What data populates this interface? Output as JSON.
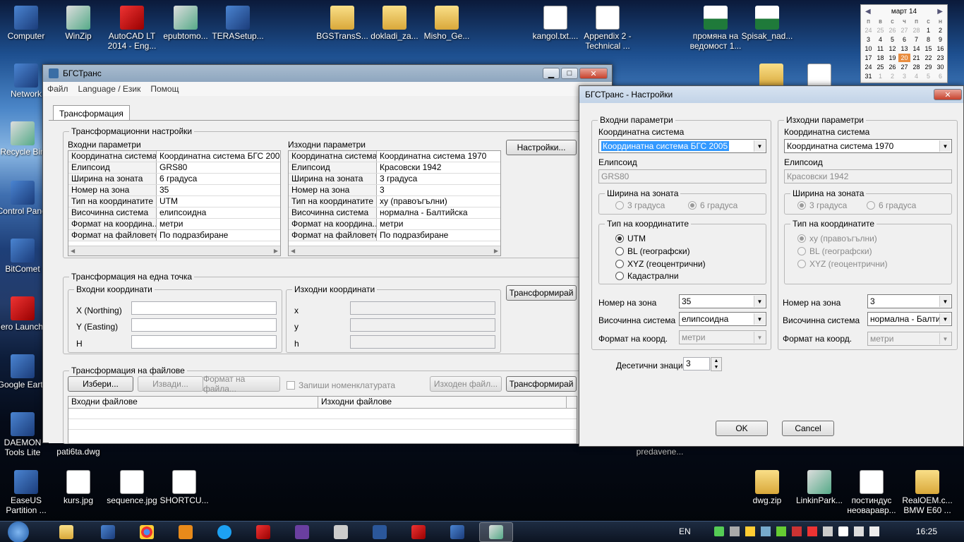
{
  "desktop_icons": {
    "computer": "Computer",
    "winzip": "WinZip",
    "autocad": "AutoCAD LT 2014 - Eng...",
    "epub": "epubtomo...",
    "tera": "TERASetup...",
    "bgstrans": "BGSTransS...",
    "dokladi": "dokladi_za...",
    "misho": "Misho_Ge...",
    "kangol": "kangol.txt....",
    "appendix": "Appendix 2 - Technical ...",
    "promyana": "промяна на ведомост 1...",
    "spisak": "Spisak_nad...",
    "network": "Network",
    "recycle": "Recycle Bin",
    "control": "Control Panel",
    "bitcomet": "BitComet",
    "nero": "Nero Launcher",
    "google": "Google Earth",
    "daemon": "DAEMON Tools Lite",
    "pati": "pati6ta.dwg",
    "easeus": "EaseUS Partition ...",
    "kurs": "kurs.jpg",
    "sequence": "sequence.jpg",
    "shortcut": "SHORTCU...",
    "predavane": "predavene...",
    "dwgzip": "dwg.zip",
    "linkin": "LinkinPark...",
    "postind": "постиндус неоваравр...",
    "realoem": "RealOEM.c... BMW E60 ..."
  },
  "calendar": {
    "month": "март 14",
    "prev": "◀",
    "next": "▶",
    "days": [
      "п",
      "в",
      "с",
      "ч",
      "п",
      "с",
      "н"
    ],
    "rows": [
      [
        "24",
        "25",
        "26",
        "27",
        "28",
        "1",
        "2"
      ],
      [
        "3",
        "4",
        "5",
        "6",
        "7",
        "8",
        "9"
      ],
      [
        "10",
        "11",
        "12",
        "13",
        "14",
        "15",
        "16"
      ],
      [
        "17",
        "18",
        "19",
        "20",
        "21",
        "22",
        "23"
      ],
      [
        "24",
        "25",
        "26",
        "27",
        "28",
        "29",
        "30"
      ],
      [
        "31",
        "1",
        "2",
        "3",
        "4",
        "5",
        "6"
      ]
    ]
  },
  "main": {
    "title": "БГСТранс",
    "menu": [
      "Файл",
      "Language / Език",
      "Помощ"
    ],
    "tab": "Трансформация",
    "settings_group": "Трансформационни настройки",
    "input_params": "Входни параметри",
    "output_params": "Изходни параметри",
    "settings_btn": "Настройки...",
    "input_rows": [
      [
        "Координатна система",
        "Координатна система БГС 200"
      ],
      [
        "Елипсоид",
        "GRS80"
      ],
      [
        "Ширина на зоната",
        "6 градуса"
      ],
      [
        "Номер на зона",
        "35"
      ],
      [
        "Тип на координатите",
        "UTM"
      ],
      [
        "Височинна система",
        "елипсоидна"
      ],
      [
        "Формат на координа...",
        "метри"
      ],
      [
        "Формат на файловете",
        "По подразбиране"
      ]
    ],
    "output_rows": [
      [
        "Координатна система",
        "Координатна система 1970"
      ],
      [
        "Елипсоид",
        "Красовски 1942"
      ],
      [
        "Ширина на зоната",
        "3 градуса"
      ],
      [
        "Номер на зона",
        "3"
      ],
      [
        "Тип на координатите",
        "xy (правоъгълни)"
      ],
      [
        "Височинна система",
        "нормална - Балтийска"
      ],
      [
        "Формат на координа...",
        "метри"
      ],
      [
        "Формат на файловете",
        "По подразбиране"
      ]
    ],
    "point_group": "Трансформация на една точка",
    "input_coords": "Входни координати",
    "output_coords": "Изходни координати",
    "xn": "X (Northing)",
    "ye": "Y (Easting)",
    "h": "H",
    "ox": "x",
    "oy": "y",
    "oh": "h",
    "transform_btn": "Трансформирай",
    "files_group": "Трансформация на файлове",
    "choose_btn": "Избери...",
    "remove_btn": "Извади...",
    "format_btn": "Формат на файла...",
    "save_nom": "Запиши номенклатурата",
    "out_file_btn": "Изходен файл...",
    "transform_files_btn": "Трансформирай",
    "col_in": "Входни файлове",
    "col_out": "Изходни файлове"
  },
  "dialog": {
    "title": "БГСТранс - Настройки",
    "in_group": "Входни параметри",
    "out_group": "Изходни параметри",
    "coord_sys": "Координатна система",
    "in_coord_sys": "Координатна система БГС 2005",
    "out_coord_sys": "Координатна система 1970",
    "ellipsoid": "Елипсоид",
    "in_ellipsoid": "GRS80",
    "out_ellipsoid": "Красовски 1942",
    "zone_width": "Ширина на зоната",
    "deg3": "3 градуса",
    "deg6": "6 градуса",
    "coord_type": "Тип на координатите",
    "in_types": [
      "UTM",
      "BL (географски)",
      "XYZ (геоцентрични)",
      "Кадастрални"
    ],
    "out_types": [
      "xy (правоъгълни)",
      "BL (географски)",
      "XYZ (геоцентрични)"
    ],
    "zone_no": "Номер на зона",
    "in_zone": "35",
    "out_zone": "3",
    "height_sys": "Височинна система",
    "in_height": "елипсоидна",
    "out_height": "нормална - Балтийс",
    "coord_fmt": "Формат на коорд.",
    "in_fmt": "метри",
    "out_fmt": "метри",
    "decimals": "Десетични знаци",
    "decimals_val": "3",
    "ok": "OK",
    "cancel": "Cancel"
  },
  "taskbar": {
    "lang": "EN",
    "time": "16:25"
  }
}
